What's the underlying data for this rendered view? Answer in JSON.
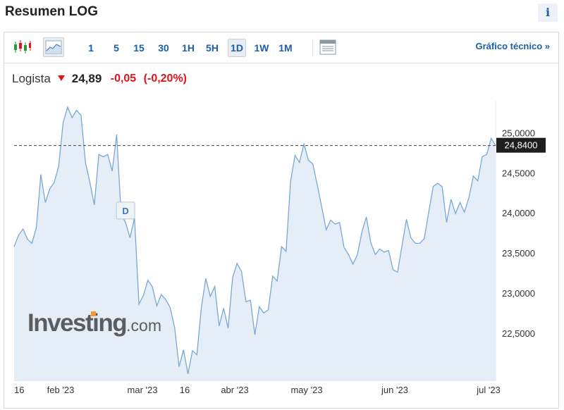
{
  "page": {
    "title": "Resumen LOG",
    "info_label": "i"
  },
  "toolbar": {
    "icons": [
      "candlestick-chart-icon",
      "area-chart-icon",
      "table-icon"
    ],
    "periods": [
      "1",
      "5",
      "15",
      "30",
      "1H",
      "5H",
      "1D",
      "1W",
      "1M"
    ],
    "active_period": "1D",
    "technical_link": "Gráfico técnico »"
  },
  "quote": {
    "name": "Logista",
    "price": "24,89",
    "change": "-0,05",
    "change_pct": "(-0,20%)",
    "direction": "down"
  },
  "watermark": {
    "brand": "Investing",
    "suffix": ".com"
  },
  "colors": {
    "accent": "#1a5fa8",
    "negative": "#e0141a",
    "line": "#7aa7d6",
    "area": "#e5eef6"
  },
  "chart_data": {
    "type": "area",
    "x_tick_labels": [
      "16",
      "feb '23",
      "mar '23",
      "16",
      "abr '23",
      "may '23",
      "jun '23",
      "jul '23"
    ],
    "y_tick_labels": [
      "25,0000",
      "24,5000",
      "24,0000",
      "23,5000",
      "23,0000",
      "22,5000"
    ],
    "ylim": [
      21.9,
      25.4
    ],
    "last_value": 24.84,
    "last_value_label": "24,8400",
    "marker_label": "D",
    "grid": false,
    "series": [
      {
        "values": [
          23.58,
          23.72,
          23.8,
          23.67,
          23.62,
          23.82,
          24.48,
          24.13,
          24.3,
          24.38,
          24.58,
          25.13,
          25.32,
          25.19,
          25.28,
          25.22,
          24.63,
          24.38,
          24.1,
          24.73,
          24.7,
          24.73,
          24.52,
          24.98,
          23.98,
          23.88,
          23.69,
          23.94,
          22.86,
          22.97,
          23.16,
          23.08,
          22.84,
          22.98,
          22.92,
          22.82,
          22.57,
          22.08,
          22.29,
          21.99,
          22.28,
          22.23,
          22.82,
          23.18,
          22.96,
          23.08,
          22.59,
          22.81,
          22.56,
          23.19,
          23.37,
          23.27,
          22.89,
          22.91,
          22.48,
          22.83,
          22.75,
          22.79,
          23.21,
          23.15,
          23.58,
          23.52,
          24.39,
          24.72,
          24.63,
          24.86,
          24.66,
          24.61,
          24.35,
          24.07,
          23.79,
          23.91,
          23.86,
          23.88,
          23.57,
          23.48,
          23.36,
          23.48,
          23.76,
          23.95,
          23.63,
          23.48,
          23.55,
          23.51,
          23.53,
          23.29,
          23.26,
          23.59,
          23.92,
          23.69,
          23.62,
          23.62,
          23.68,
          24.01,
          24.33,
          24.37,
          24.33,
          23.88,
          24.17,
          23.99,
          24.13,
          24.01,
          24.19,
          24.46,
          24.4,
          24.7,
          24.73,
          24.93,
          24.84
        ]
      }
    ]
  }
}
